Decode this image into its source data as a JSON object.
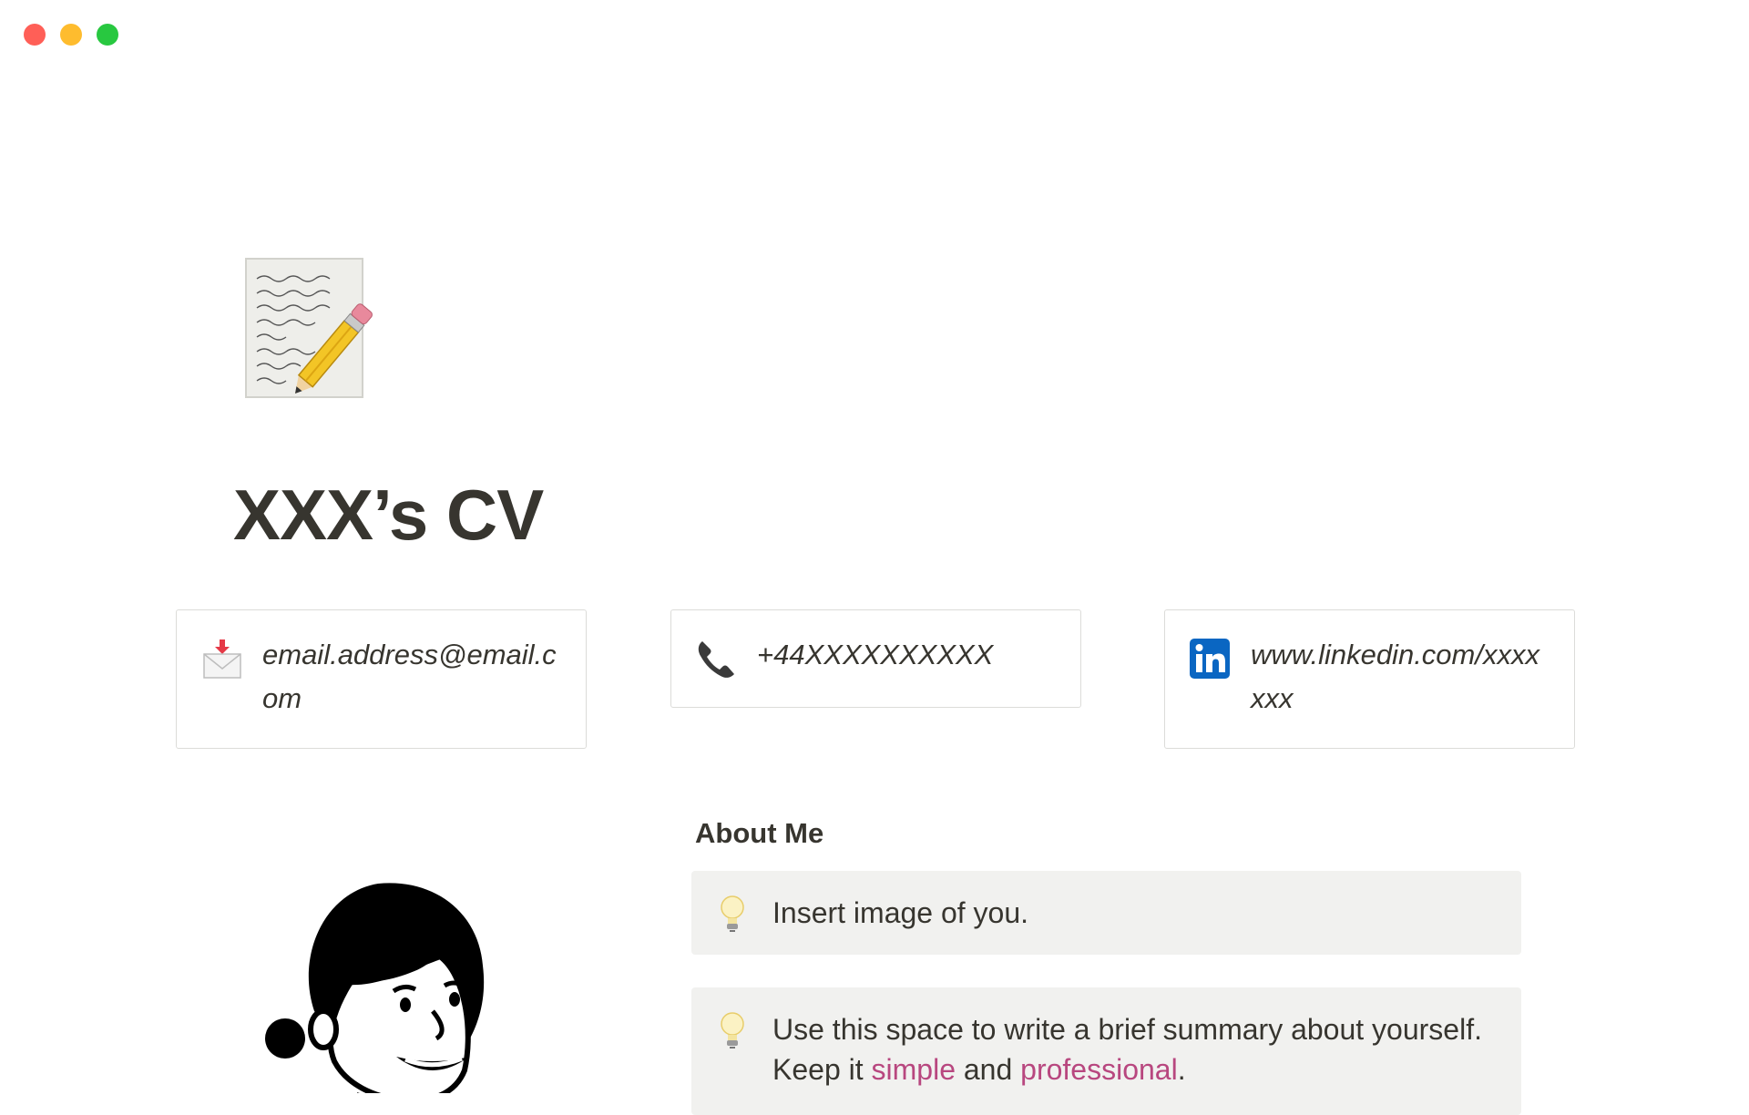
{
  "window": {
    "controls": {
      "close_color": "#ff5f57",
      "minimize_color": "#febc2e",
      "maximize_color": "#28c840"
    }
  },
  "page": {
    "icon": "memo-pencil-icon",
    "title": "XXX’s CV"
  },
  "contacts": [
    {
      "icon": "envelope-arrow-icon",
      "text": "email.address@email.com"
    },
    {
      "icon": "telephone-receiver-icon",
      "text": "+44XXXXXXXXXX"
    },
    {
      "icon": "linkedin-icon",
      "text": "www.linkedin.com/xxxxxxx"
    }
  ],
  "avatar": {
    "icon": "person-illustration"
  },
  "about": {
    "title": "About Me",
    "callouts": [
      {
        "icon": "light-bulb-icon",
        "text": "Insert image of you."
      },
      {
        "icon": "light-bulb-icon",
        "text_before": "Use this space to write a brief summary about yourself. Keep it ",
        "link1": "simple",
        "text_middle": " and ",
        "link2": "professional",
        "text_after": "."
      }
    ]
  },
  "colors": {
    "text": "#37352f",
    "callout_bg": "#f1f1ef",
    "card_border": "#dcdcd9",
    "highlight": "#b8477f",
    "linkedin_blue": "#0a66c2"
  }
}
